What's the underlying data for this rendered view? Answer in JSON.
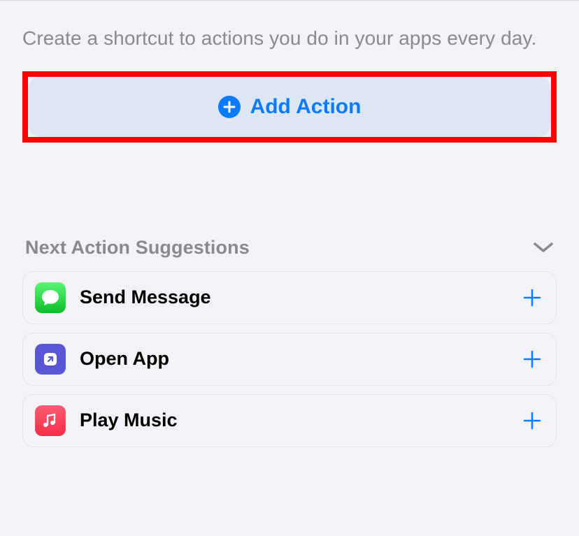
{
  "description": "Create a shortcut to actions you do in your apps every day.",
  "addAction": {
    "label": "Add Action"
  },
  "suggestions": {
    "title": "Next Action Suggestions",
    "items": [
      {
        "label": "Send Message"
      },
      {
        "label": "Open App"
      },
      {
        "label": "Play Music"
      }
    ]
  }
}
